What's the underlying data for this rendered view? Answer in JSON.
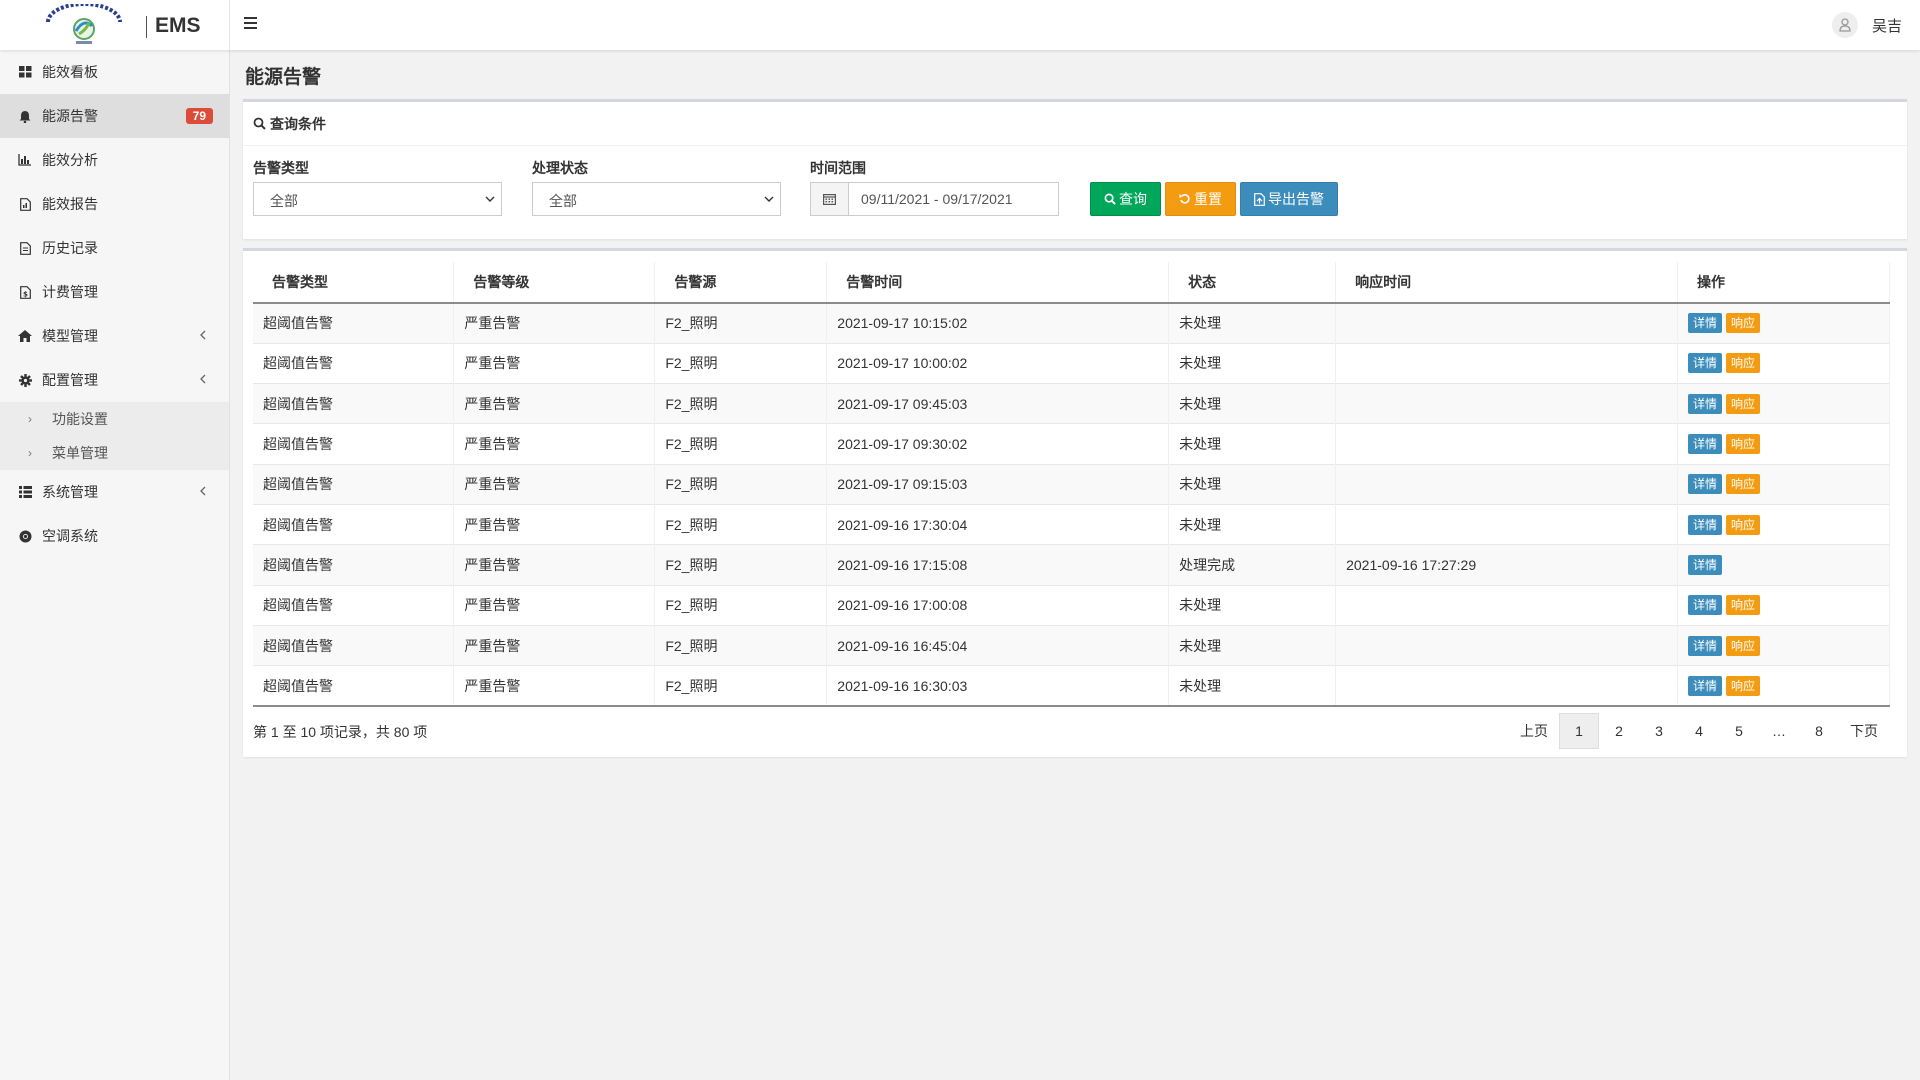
{
  "app": {
    "brand": "EMS",
    "user": "吴吉"
  },
  "sidebar": {
    "items": [
      {
        "label": "能效看板",
        "icon": "dashboard-icon"
      },
      {
        "label": "能源告警",
        "icon": "bell-icon",
        "badge": "79",
        "active": true
      },
      {
        "label": "能效分析",
        "icon": "bar-chart-icon"
      },
      {
        "label": "能效报告",
        "icon": "report-icon"
      },
      {
        "label": "历史记录",
        "icon": "file-text-icon"
      },
      {
        "label": "计费管理",
        "icon": "billing-icon"
      },
      {
        "label": "模型管理",
        "icon": "home-icon",
        "chevron": true
      },
      {
        "label": "配置管理",
        "icon": "gear-icon",
        "chevron": true
      },
      {
        "label": "系统管理",
        "icon": "list-icon",
        "chevron": true
      },
      {
        "label": "空调系统",
        "icon": "chrome-icon"
      }
    ],
    "submenu": [
      {
        "label": "功能设置"
      },
      {
        "label": "菜单管理"
      }
    ]
  },
  "page": {
    "title": "能源告警"
  },
  "query": {
    "heading": "查询条件",
    "alarm_type_label": "告警类型",
    "alarm_type_value": "全部",
    "status_label": "处理状态",
    "status_value": "全部",
    "time_label": "时间范围",
    "time_value": "09/11/2021 - 09/17/2021",
    "search_btn": "查询",
    "reset_btn": "重置",
    "export_btn": "导出告警"
  },
  "table": {
    "headers": [
      "告警类型",
      "告警等级",
      "告警源",
      "告警时间",
      "状态",
      "响应时间",
      "操作"
    ],
    "detail_label": "详情",
    "respond_label": "响应",
    "rows": [
      {
        "type": "超阈值告警",
        "level": "严重告警",
        "source": "F2_照明",
        "time": "2021-09-17 10:15:02",
        "status": "未处理",
        "response": "",
        "can_respond": true
      },
      {
        "type": "超阈值告警",
        "level": "严重告警",
        "source": "F2_照明",
        "time": "2021-09-17 10:00:02",
        "status": "未处理",
        "response": "",
        "can_respond": true
      },
      {
        "type": "超阈值告警",
        "level": "严重告警",
        "source": "F2_照明",
        "time": "2021-09-17 09:45:03",
        "status": "未处理",
        "response": "",
        "can_respond": true
      },
      {
        "type": "超阈值告警",
        "level": "严重告警",
        "source": "F2_照明",
        "time": "2021-09-17 09:30:02",
        "status": "未处理",
        "response": "",
        "can_respond": true
      },
      {
        "type": "超阈值告警",
        "level": "严重告警",
        "source": "F2_照明",
        "time": "2021-09-17 09:15:03",
        "status": "未处理",
        "response": "",
        "can_respond": true
      },
      {
        "type": "超阈值告警",
        "level": "严重告警",
        "source": "F2_照明",
        "time": "2021-09-16 17:30:04",
        "status": "未处理",
        "response": "",
        "can_respond": true
      },
      {
        "type": "超阈值告警",
        "level": "严重告警",
        "source": "F2_照明",
        "time": "2021-09-16 17:15:08",
        "status": "处理完成",
        "response": "2021-09-16 17:27:29",
        "can_respond": false
      },
      {
        "type": "超阈值告警",
        "level": "严重告警",
        "source": "F2_照明",
        "time": "2021-09-16 17:00:08",
        "status": "未处理",
        "response": "",
        "can_respond": true
      },
      {
        "type": "超阈值告警",
        "level": "严重告警",
        "source": "F2_照明",
        "time": "2021-09-16 16:45:04",
        "status": "未处理",
        "response": "",
        "can_respond": true
      },
      {
        "type": "超阈值告警",
        "level": "严重告警",
        "source": "F2_照明",
        "time": "2021-09-16 16:30:03",
        "status": "未处理",
        "response": "",
        "can_respond": true
      }
    ],
    "info": "第 1 至 10 项记录，共 80 项"
  },
  "pagination": {
    "prev": "上页",
    "next": "下页",
    "pages": [
      "1",
      "2",
      "3",
      "4",
      "5",
      "…",
      "8"
    ],
    "current": "1"
  },
  "colors": {
    "accent_green": "#00a65a",
    "accent_orange": "#f39c12",
    "accent_blue": "#3c8dbc",
    "badge_red": "#dd4b39"
  }
}
